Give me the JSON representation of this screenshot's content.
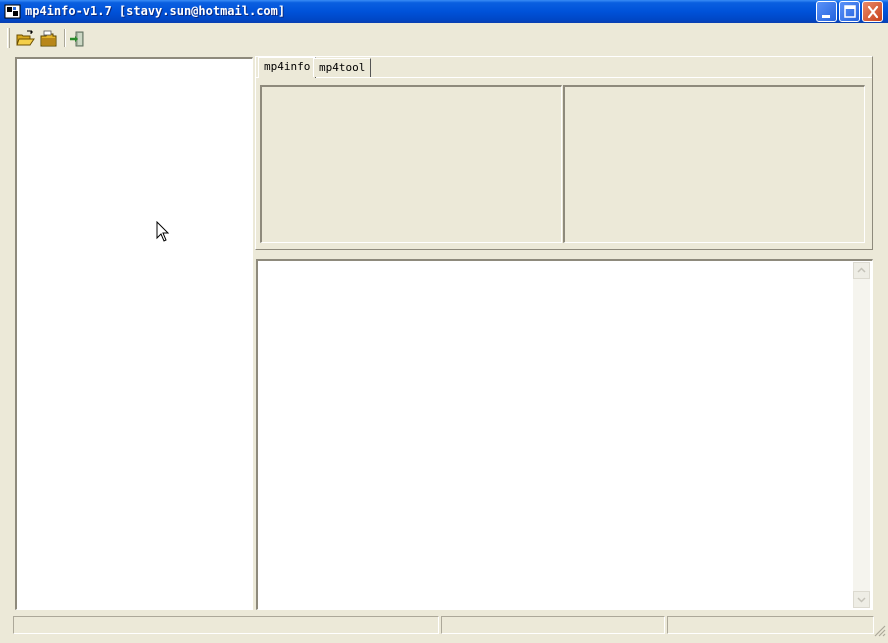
{
  "window": {
    "title": "mp4info-v1.7 [stavy.sun@hotmail.com]"
  },
  "toolbar": {
    "buttons": [
      {
        "name": "open-file",
        "icon": "open-folder-icon"
      },
      {
        "name": "open-folder",
        "icon": "folder-icon"
      },
      {
        "name": "exit",
        "icon": "exit-door-icon"
      }
    ]
  },
  "tabs": [
    {
      "label": "mp4info",
      "active": true
    },
    {
      "label": "mp4tool",
      "active": false
    }
  ],
  "statusbar": {
    "panes": [
      "",
      "",
      ""
    ]
  },
  "colors": {
    "titlebar": "#0052d9",
    "face": "#ece9d8",
    "panel": "#ffffff"
  }
}
